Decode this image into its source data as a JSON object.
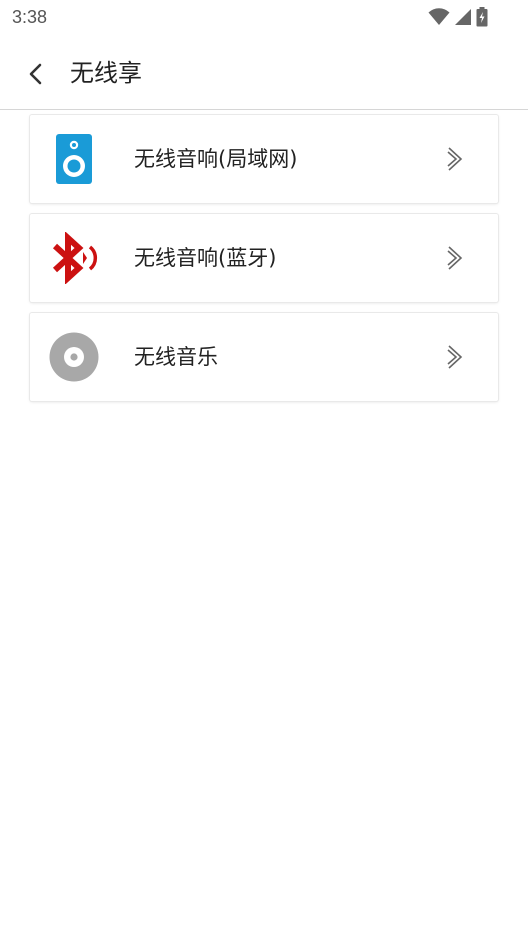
{
  "status_bar": {
    "time": "3:38",
    "icons": [
      "wifi-icon",
      "signal-icon",
      "battery-charging-icon"
    ]
  },
  "app_bar": {
    "back_icon": "chevron-left-icon",
    "title": "无线享"
  },
  "items": [
    {
      "label": "无线音响(局域网)",
      "icon": "speaker-icon",
      "icon_color": "#1a9bd7"
    },
    {
      "label": "无线音响(蓝牙)",
      "icon": "bluetooth-icon",
      "icon_color": "#cc1111"
    },
    {
      "label": "无线音乐",
      "icon": "disc-icon",
      "icon_color": "#a8a8a8"
    }
  ],
  "colors": {
    "background": "#ffffff",
    "divider": "#d6d6d6",
    "text": "#222222",
    "chevron": "#666666"
  }
}
